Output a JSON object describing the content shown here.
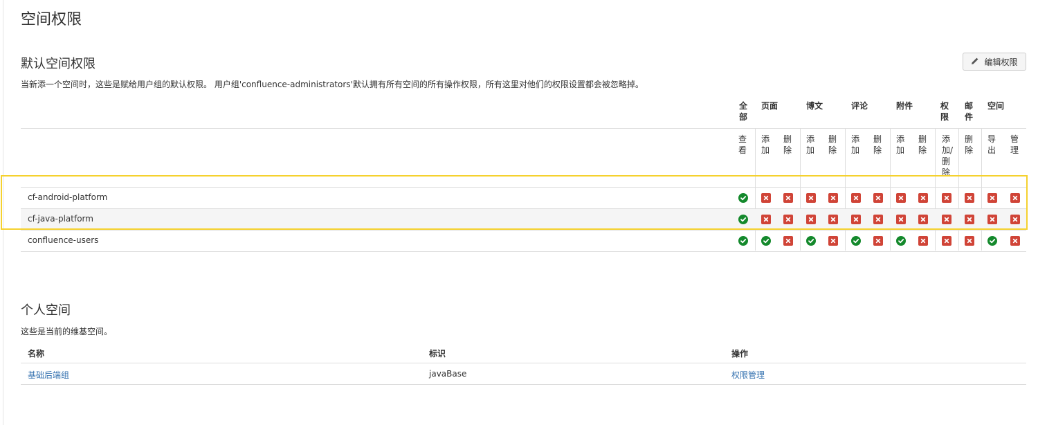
{
  "page_title": "空间权限",
  "default_section": {
    "title": "默认空间权限",
    "edit_button": "编辑权限",
    "description": "当新添一个空间时，这些是赋给用户组的默认权限。 用户组'confluence-administrators'默认拥有所有空间的所有操作权限，所有这里对他们的权限设置都会被忽略掉。"
  },
  "permission_groups": [
    "全部",
    "页面",
    "博文",
    "评论",
    "附件",
    "权限",
    "邮件",
    "空间"
  ],
  "permission_columns": [
    "查看",
    "添加",
    "删除",
    "添加",
    "删除",
    "添加",
    "删除",
    "添加",
    "删除",
    "添加/删除",
    "删除",
    "导出",
    "管理"
  ],
  "user_groups": [
    {
      "name": "cf-android-platform",
      "perms": [
        true,
        false,
        false,
        false,
        false,
        false,
        false,
        false,
        false,
        false,
        false,
        false,
        false
      ]
    },
    {
      "name": "cf-java-platform",
      "perms": [
        true,
        false,
        false,
        false,
        false,
        false,
        false,
        false,
        false,
        false,
        false,
        false,
        false
      ]
    },
    {
      "name": "confluence-users",
      "perms": [
        true,
        true,
        false,
        true,
        false,
        true,
        false,
        true,
        false,
        false,
        false,
        true,
        false
      ]
    }
  ],
  "personal_section": {
    "title": "个人空间",
    "description": "这些是当前的维基空间。",
    "headers": [
      "名称",
      "标识",
      "操作"
    ],
    "rows": [
      {
        "name": "基础后端组",
        "key": "javaBase",
        "action": "权限管理"
      }
    ]
  },
  "colors": {
    "granted": "#14892c",
    "denied": "#d04437",
    "highlight": "#f5d12e",
    "link": "#3572b0"
  },
  "icons": {
    "granted": "check-icon",
    "denied": "cross-icon",
    "edit": "pencil-icon"
  }
}
